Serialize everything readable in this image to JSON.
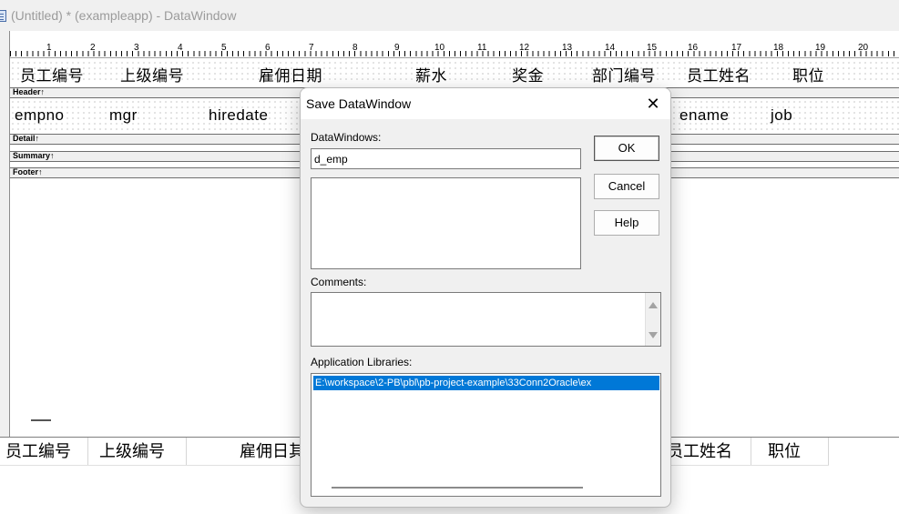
{
  "window": {
    "title": "(Untitled) * (exampleapp) - DataWindow"
  },
  "ruler": {
    "numbers": [
      "1",
      "2",
      "3",
      "4",
      "5",
      "6",
      "7",
      "8",
      "9",
      "10",
      "11",
      "12",
      "13",
      "14",
      "15",
      "16",
      "17",
      "18",
      "19",
      "20"
    ]
  },
  "header_band": {
    "label": "Header↑",
    "columns": [
      "员工编号",
      "上级编号",
      "雇佣日期",
      "薪水",
      "奖金",
      "部门编号",
      "员工姓名",
      "职位"
    ]
  },
  "detail_band": {
    "label": "Detail↑",
    "fields": [
      "empno",
      "mgr",
      "hiredate",
      "ename",
      "job"
    ]
  },
  "summary_band": {
    "label": "Summary↑"
  },
  "footer_band": {
    "label": "Footer↑"
  },
  "preview": {
    "columns": [
      "员工编号",
      "上级编号",
      "雇佣日其",
      "员工姓名",
      "职位"
    ]
  },
  "dialog": {
    "title": "Save DataWindow",
    "close_glyph": "✕",
    "datawindows_label": "DataWindows:",
    "datawindows_value": "d_emp",
    "ok_label": "OK",
    "cancel_label": "Cancel",
    "help_label": "Help",
    "comments_label": "Comments:",
    "libraries_label": "Application Libraries:",
    "libraries": [
      "E:\\workspace\\2-PB\\pbl\\pb-project-example\\33Conn2Oracle\\ex"
    ]
  }
}
